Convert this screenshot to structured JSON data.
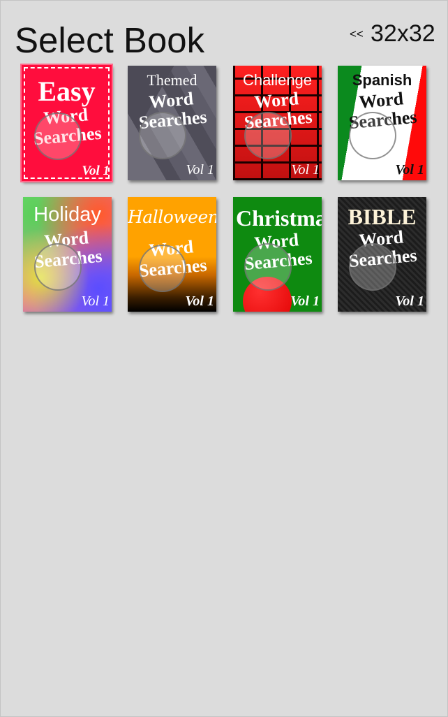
{
  "header": {
    "title": "Select Book",
    "back_label": "<<",
    "grid_size": "32x32"
  },
  "books": [
    {
      "name": "Easy",
      "line1": "Word",
      "line2": "Searches",
      "volume": "Vol 1",
      "selected": true
    },
    {
      "name": "Themed",
      "line1": "Word",
      "line2": "Searches",
      "volume": "Vol 1"
    },
    {
      "name": "Challenge",
      "line1": "Word",
      "line2": "Searches",
      "volume": "Vol 1"
    },
    {
      "name": "Spanish",
      "line1": "Word",
      "line2": "Searches",
      "volume": "Vol 1"
    },
    {
      "name": "Holiday",
      "line1": "Word",
      "line2": "Searches",
      "volume": "Vol 1"
    },
    {
      "name": "Halloween",
      "line1": "Word",
      "line2": "Searches",
      "volume": "Vol 1"
    },
    {
      "name": "Christmas",
      "line1": "Word",
      "line2": "Searches",
      "volume": "Vol 1"
    },
    {
      "name": "BIBLE",
      "line1": "Word",
      "line2": "Searches",
      "volume": "Vol 1"
    }
  ],
  "colors": {
    "background": "#dcdcdc",
    "easy": "#ff0d3d",
    "themed": "#5d5b68",
    "challenge": "#d01515",
    "spanish_green": "#0b8a1e",
    "spanish_red": "#ff0a0a",
    "halloween": "#ffa200",
    "christmas": "#0e8a10",
    "bible": "#242424"
  }
}
